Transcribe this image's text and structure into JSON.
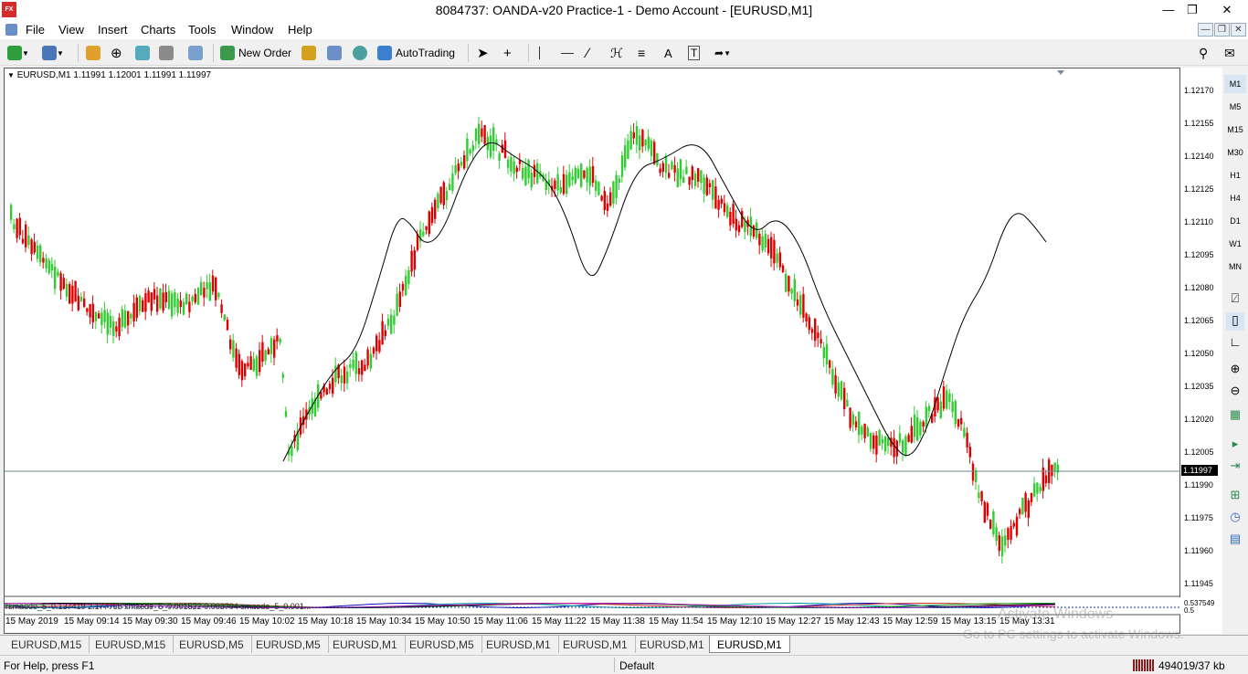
{
  "titlebar": {
    "title": "8084737: OANDA-v20 Practice-1 - Demo Account - [EURUSD,M1]",
    "app_icon_text": "FX"
  },
  "menu": [
    "File",
    "View",
    "Insert",
    "Charts",
    "Tools",
    "Window",
    "Help"
  ],
  "toolbar": {
    "new_order_label": "New Order",
    "autotrading_label": "AutoTrading"
  },
  "chart": {
    "header": "EURUSD,M1  1.11991 1.12001 1.11991 1.11997",
    "current_price": "1.11997",
    "price_labels": [
      "1.12170",
      "1.12155",
      "1.12140",
      "1.12125",
      "1.12110",
      "1.12095",
      "1.12080",
      "1.12065",
      "1.12050",
      "1.12035",
      "1.12020",
      "1.12005",
      "1.11990",
      "1.11975",
      "1.11960",
      "1.11945"
    ],
    "osc_price_labels": [
      "0.537549",
      "0.5"
    ],
    "osc_text": "rsmaede_5_0.137419 2.177765 smaede_5_0.001522 0.003704 smaede_5_0.001...",
    "time_labels": [
      "15 May 2019",
      "15 May 09:14",
      "15 May 09:30",
      "15 May 09:46",
      "15 May 10:02",
      "15 May 10:18",
      "15 May 10:34",
      "15 May 10:50",
      "15 May 11:06",
      "15 May 11:22",
      "15 May 11:38",
      "15 May 11:54",
      "15 May 12:10",
      "15 May 12:27",
      "15 May 12:43",
      "15 May 12:59",
      "15 May 13:15",
      "15 May 13:31"
    ],
    "colors": {
      "bull": "#32cd32",
      "bear": "#e00000",
      "line": "#000000"
    }
  },
  "timeframes": [
    "M1",
    "M5",
    "M15",
    "M30",
    "H1",
    "H4",
    "D1",
    "W1",
    "MN"
  ],
  "tabs": [
    "EURUSD,M15",
    "EURUSD,M15",
    "EURUSD,M5",
    "EURUSD,M5",
    "EURUSD,M1",
    "EURUSD,M5",
    "EURUSD,M1",
    "EURUSD,M1",
    "EURUSD,M1",
    "EURUSD,M1"
  ],
  "status": {
    "help": "For Help, press F1",
    "profile": "Default",
    "traffic": "494019/37 kb"
  },
  "watermark": {
    "line1": "Activate Windows",
    "line2": "Go to PC settings to activate Windows."
  }
}
